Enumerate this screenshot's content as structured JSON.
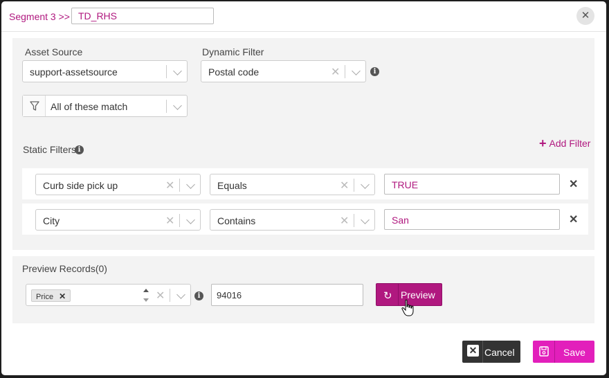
{
  "header": {
    "breadcrumb": "Segment 3 >>",
    "segment_name": "TD_RHS",
    "close_icon": "close-icon"
  },
  "config": {
    "asset_source_label": "Asset Source",
    "asset_source_value": "support-assetsource",
    "dynamic_filter_label": "Dynamic Filter",
    "dynamic_filter_value": "Postal code",
    "match_value": "All of these match",
    "static_filters_label": "Static Filters",
    "add_filter_label": "Add Filter",
    "filters": [
      {
        "field": "Curb side pick up",
        "operator": "Equals",
        "value": "TRUE"
      },
      {
        "field": "City",
        "operator": "Contains",
        "value": "San"
      }
    ]
  },
  "preview": {
    "title": "Preview Records(0)",
    "tag": "Price",
    "value": "94016",
    "button_label": "Preview"
  },
  "footer": {
    "cancel_label": "Cancel",
    "save_label": "Save"
  },
  "colors": {
    "accent": "#b0187f",
    "save": "#e21fbb",
    "cancel": "#333333"
  }
}
